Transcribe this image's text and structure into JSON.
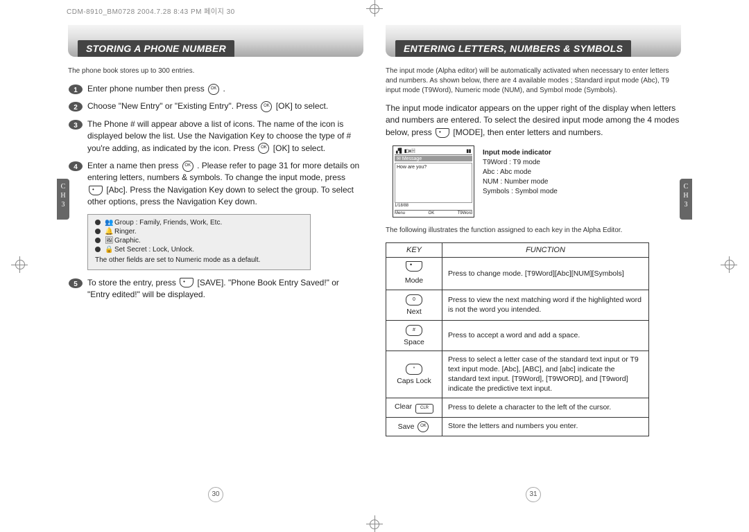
{
  "header": "CDM-8910_BM0728  2004.7.28 8:43 PM  페이지 30",
  "left": {
    "title": "STORING A PHONE NUMBER",
    "intro": "The phone book stores up to 300 entries.",
    "steps": {
      "s1": "Enter phone number then press ",
      "s1_tail": " .",
      "s2": "Choose \"New Entry\" or \"Existing Entry\". Press ",
      "s2_tail": " [OK] to select.",
      "s3": "The Phone # will appear above a list of icons. The name of the icon is displayed below the list. Use the Navigation Key to choose the type of # you're adding, as indicated by the icon. Press ",
      "s3_tail": " [OK] to select.",
      "s4": "Enter a name then press ",
      "s4a": " . Please refer to page 31 for more details on entering letters, numbers & symbols. To change the input mode, press ",
      "s4b": " [Abc]. Press the Navigation Key down to select the group. To select other options, press the Navigation Key down.",
      "s5": "To store the entry, press ",
      "s5a": " [SAVE]. \"Phone Book Entry Saved!\" or \"Entry edited!\" will be displayed."
    },
    "box": {
      "l1": "Group : Family, Friends, Work, Etc.",
      "l2": "Ringer.",
      "l3": "Graphic.",
      "l4": "Set Secret : Lock, Unlock.",
      "note": "The other fields are set to Numeric mode as a default."
    },
    "sidetab": "C\nH\n3",
    "pagenum": "30"
  },
  "right": {
    "title": "ENTERING LETTERS, NUMBERS & SYMBOLS",
    "intro": "The input mode (Alpha editor) will be automatically activated when necessary to enter letters and numbers. As shown below, there are 4 available modes ; Standard input mode (Abc), T9 input mode (T9Word), Numeric mode (NUM), and Symbol mode (Symbols).",
    "para": "The input mode indicator appears on the upper right of the display when letters and numbers are entered. To select the desired input mode among the 4 modes below, press ",
    "para_tail": " [MODE], then enter letters and numbers.",
    "phone": {
      "sub": " Message",
      "body": "How are you?",
      "time": "1/18/88",
      "menu": "Menu",
      "ok": "OK",
      "mode": "T9Word"
    },
    "ind": {
      "title": "Input mode indicator",
      "l1": "T9Word : T9 mode",
      "l2": "Abc : Abc mode",
      "l3": "NUM : Number mode",
      "l4": "Symbols : Symbol mode"
    },
    "tablenote": "The following illustrates the function assigned to each key in the Alpha Editor.",
    "th1": "KEY",
    "th2": "FUNCTION",
    "rows": {
      "mode": {
        "label": "Mode",
        "fn": "Press to change mode. [T9Word][Abc][NUM][Symbols]"
      },
      "next": {
        "label": "Next",
        "fn": "Press to view the next matching word if the highlighted word is not the word you intended."
      },
      "space": {
        "label": "Space",
        "fn": "Press to accept a word and add a space."
      },
      "caps": {
        "label": "Caps Lock",
        "fn": "Press to select a letter case of the standard text input or T9 text input mode. [Abc], [ABC], and [abc] indicate the standard text input. [T9Word], [T9WORD], and [T9word] indicate the predictive text input."
      },
      "clear": {
        "label": "Clear",
        "fn": "Press to delete a character to the left of the cursor."
      },
      "save": {
        "label": "Save",
        "fn": "Store the letters and numbers you enter."
      }
    },
    "sidetab": "C\nH\n3",
    "pagenum": "31"
  }
}
